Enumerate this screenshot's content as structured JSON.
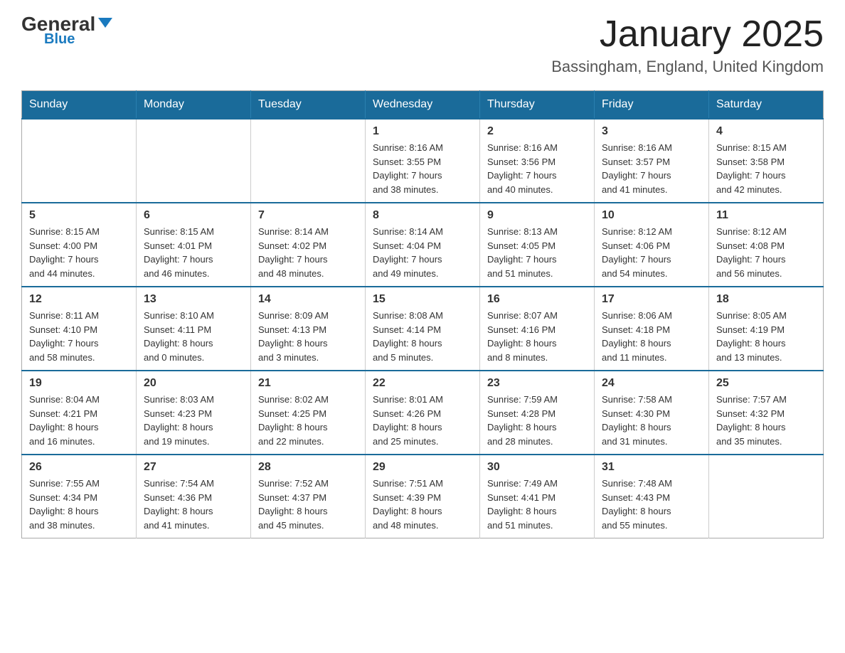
{
  "header": {
    "logo": {
      "general": "General",
      "blue": "Blue"
    },
    "title": "January 2025",
    "location": "Bassingham, England, United Kingdom"
  },
  "calendar": {
    "days_of_week": [
      "Sunday",
      "Monday",
      "Tuesday",
      "Wednesday",
      "Thursday",
      "Friday",
      "Saturday"
    ],
    "weeks": [
      [
        {
          "day": "",
          "info": ""
        },
        {
          "day": "",
          "info": ""
        },
        {
          "day": "",
          "info": ""
        },
        {
          "day": "1",
          "info": "Sunrise: 8:16 AM\nSunset: 3:55 PM\nDaylight: 7 hours\nand 38 minutes."
        },
        {
          "day": "2",
          "info": "Sunrise: 8:16 AM\nSunset: 3:56 PM\nDaylight: 7 hours\nand 40 minutes."
        },
        {
          "day": "3",
          "info": "Sunrise: 8:16 AM\nSunset: 3:57 PM\nDaylight: 7 hours\nand 41 minutes."
        },
        {
          "day": "4",
          "info": "Sunrise: 8:15 AM\nSunset: 3:58 PM\nDaylight: 7 hours\nand 42 minutes."
        }
      ],
      [
        {
          "day": "5",
          "info": "Sunrise: 8:15 AM\nSunset: 4:00 PM\nDaylight: 7 hours\nand 44 minutes."
        },
        {
          "day": "6",
          "info": "Sunrise: 8:15 AM\nSunset: 4:01 PM\nDaylight: 7 hours\nand 46 minutes."
        },
        {
          "day": "7",
          "info": "Sunrise: 8:14 AM\nSunset: 4:02 PM\nDaylight: 7 hours\nand 48 minutes."
        },
        {
          "day": "8",
          "info": "Sunrise: 8:14 AM\nSunset: 4:04 PM\nDaylight: 7 hours\nand 49 minutes."
        },
        {
          "day": "9",
          "info": "Sunrise: 8:13 AM\nSunset: 4:05 PM\nDaylight: 7 hours\nand 51 minutes."
        },
        {
          "day": "10",
          "info": "Sunrise: 8:12 AM\nSunset: 4:06 PM\nDaylight: 7 hours\nand 54 minutes."
        },
        {
          "day": "11",
          "info": "Sunrise: 8:12 AM\nSunset: 4:08 PM\nDaylight: 7 hours\nand 56 minutes."
        }
      ],
      [
        {
          "day": "12",
          "info": "Sunrise: 8:11 AM\nSunset: 4:10 PM\nDaylight: 7 hours\nand 58 minutes."
        },
        {
          "day": "13",
          "info": "Sunrise: 8:10 AM\nSunset: 4:11 PM\nDaylight: 8 hours\nand 0 minutes."
        },
        {
          "day": "14",
          "info": "Sunrise: 8:09 AM\nSunset: 4:13 PM\nDaylight: 8 hours\nand 3 minutes."
        },
        {
          "day": "15",
          "info": "Sunrise: 8:08 AM\nSunset: 4:14 PM\nDaylight: 8 hours\nand 5 minutes."
        },
        {
          "day": "16",
          "info": "Sunrise: 8:07 AM\nSunset: 4:16 PM\nDaylight: 8 hours\nand 8 minutes."
        },
        {
          "day": "17",
          "info": "Sunrise: 8:06 AM\nSunset: 4:18 PM\nDaylight: 8 hours\nand 11 minutes."
        },
        {
          "day": "18",
          "info": "Sunrise: 8:05 AM\nSunset: 4:19 PM\nDaylight: 8 hours\nand 13 minutes."
        }
      ],
      [
        {
          "day": "19",
          "info": "Sunrise: 8:04 AM\nSunset: 4:21 PM\nDaylight: 8 hours\nand 16 minutes."
        },
        {
          "day": "20",
          "info": "Sunrise: 8:03 AM\nSunset: 4:23 PM\nDaylight: 8 hours\nand 19 minutes."
        },
        {
          "day": "21",
          "info": "Sunrise: 8:02 AM\nSunset: 4:25 PM\nDaylight: 8 hours\nand 22 minutes."
        },
        {
          "day": "22",
          "info": "Sunrise: 8:01 AM\nSunset: 4:26 PM\nDaylight: 8 hours\nand 25 minutes."
        },
        {
          "day": "23",
          "info": "Sunrise: 7:59 AM\nSunset: 4:28 PM\nDaylight: 8 hours\nand 28 minutes."
        },
        {
          "day": "24",
          "info": "Sunrise: 7:58 AM\nSunset: 4:30 PM\nDaylight: 8 hours\nand 31 minutes."
        },
        {
          "day": "25",
          "info": "Sunrise: 7:57 AM\nSunset: 4:32 PM\nDaylight: 8 hours\nand 35 minutes."
        }
      ],
      [
        {
          "day": "26",
          "info": "Sunrise: 7:55 AM\nSunset: 4:34 PM\nDaylight: 8 hours\nand 38 minutes."
        },
        {
          "day": "27",
          "info": "Sunrise: 7:54 AM\nSunset: 4:36 PM\nDaylight: 8 hours\nand 41 minutes."
        },
        {
          "day": "28",
          "info": "Sunrise: 7:52 AM\nSunset: 4:37 PM\nDaylight: 8 hours\nand 45 minutes."
        },
        {
          "day": "29",
          "info": "Sunrise: 7:51 AM\nSunset: 4:39 PM\nDaylight: 8 hours\nand 48 minutes."
        },
        {
          "day": "30",
          "info": "Sunrise: 7:49 AM\nSunset: 4:41 PM\nDaylight: 8 hours\nand 51 minutes."
        },
        {
          "day": "31",
          "info": "Sunrise: 7:48 AM\nSunset: 4:43 PM\nDaylight: 8 hours\nand 55 minutes."
        },
        {
          "day": "",
          "info": ""
        }
      ]
    ]
  }
}
